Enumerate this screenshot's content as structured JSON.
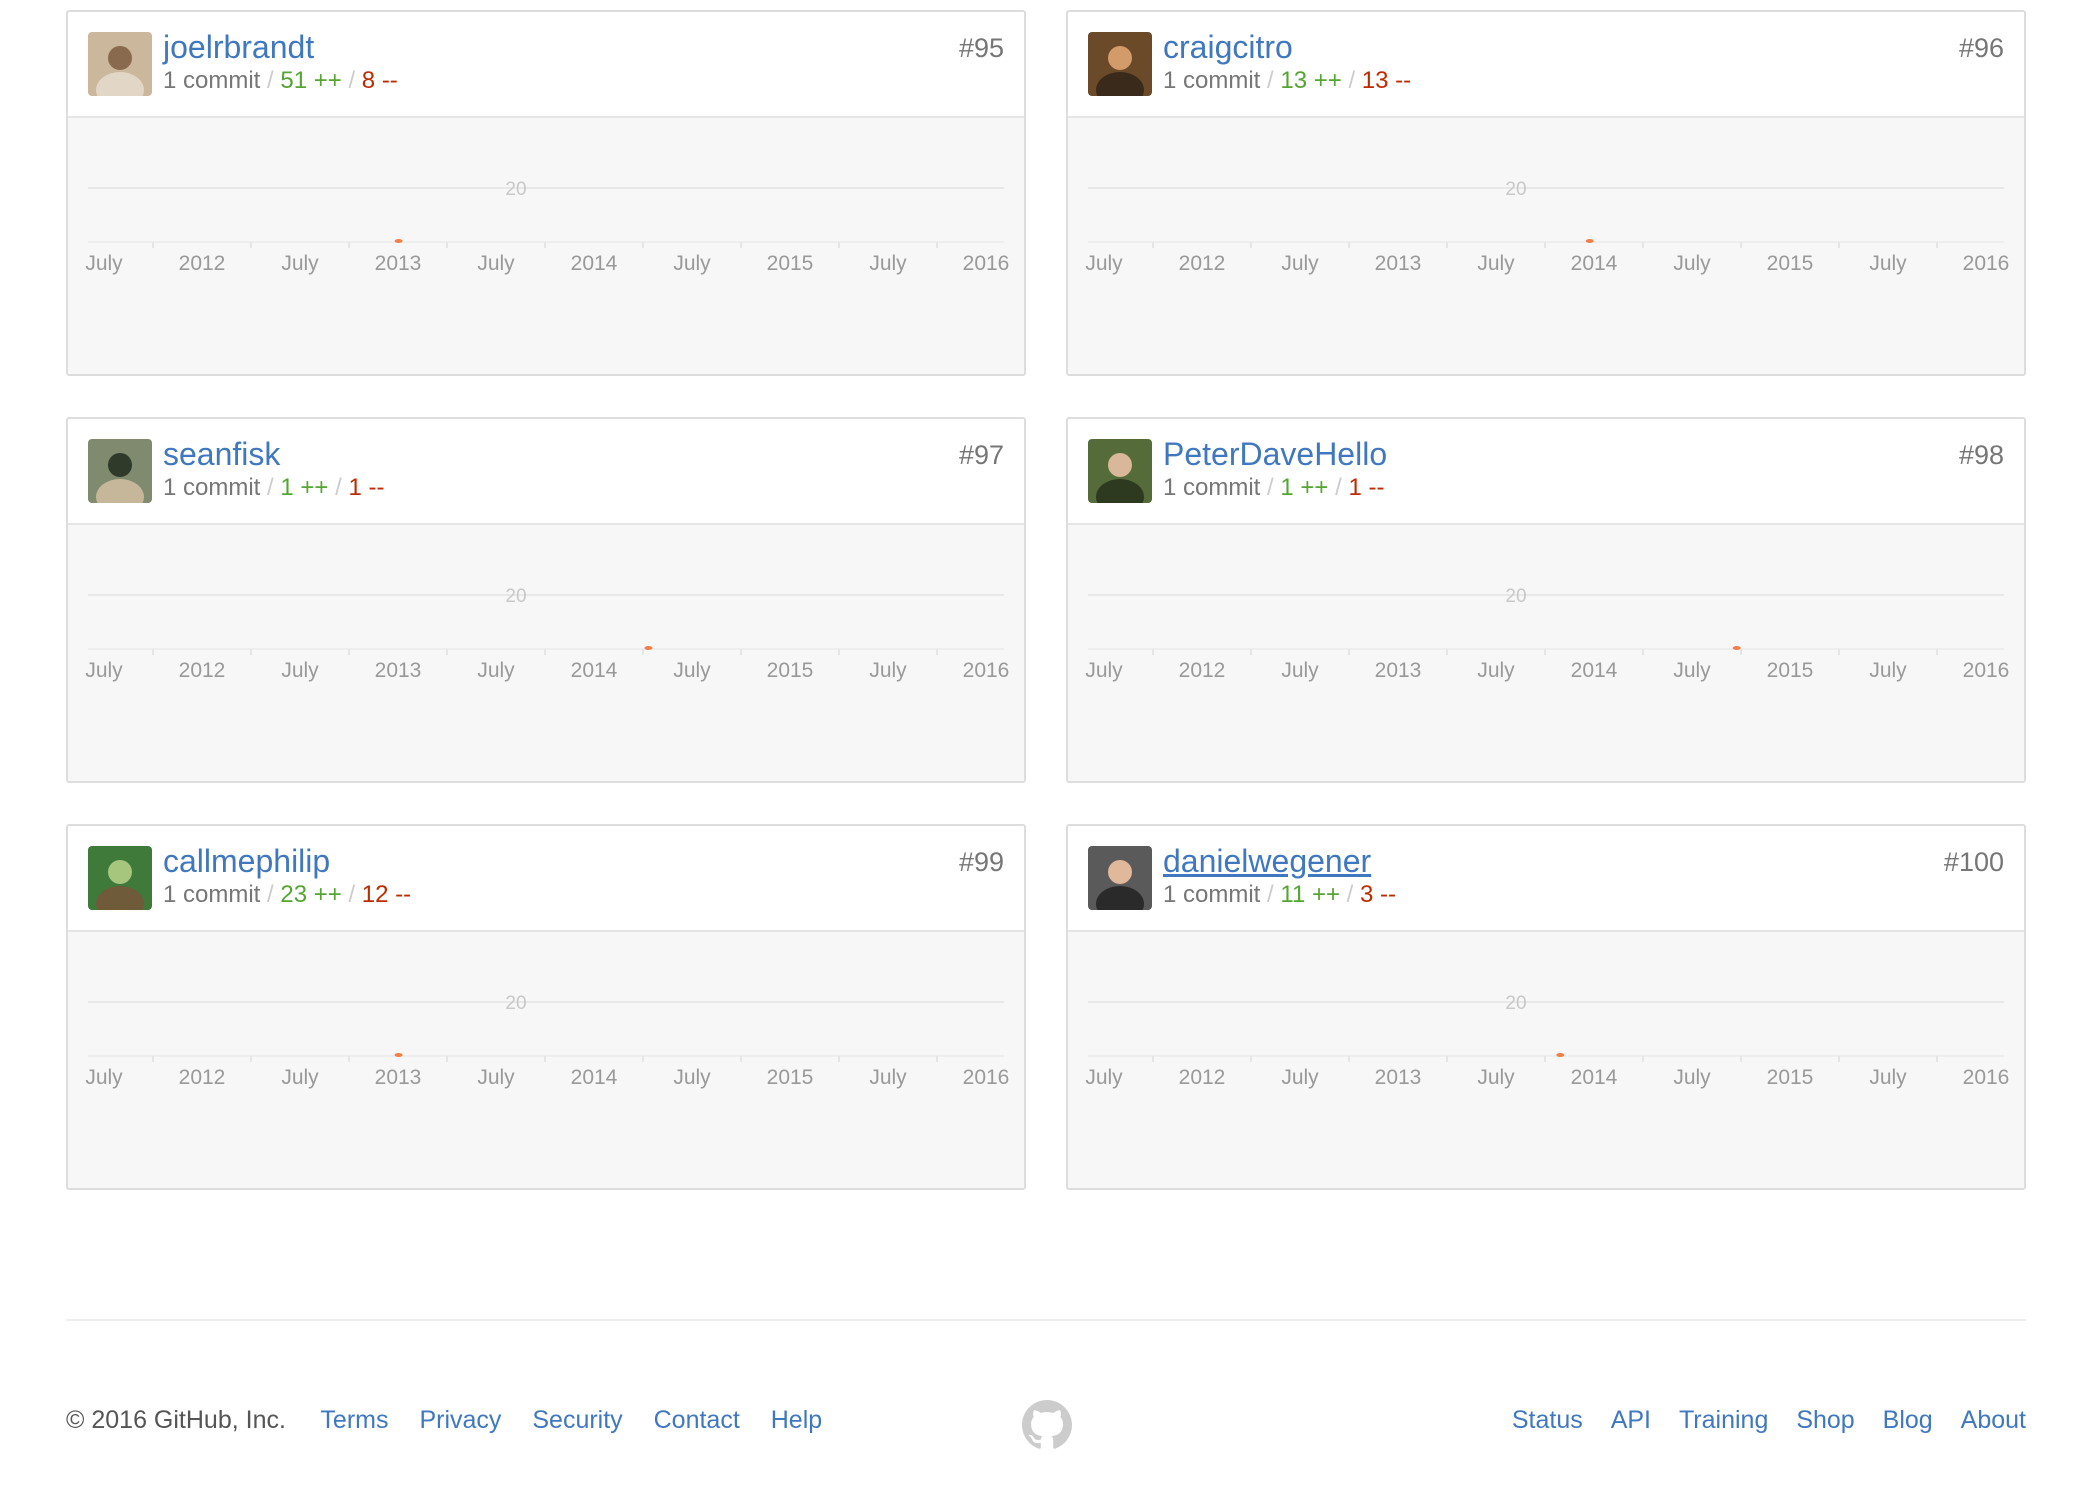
{
  "contributors": [
    {
      "username": "joelrbrandt",
      "rank": "#95",
      "commits": "1 commit",
      "additions": "51 ++",
      "deletions": "8 --",
      "avatar": "avatar-person-glasses",
      "dot_date": "2013",
      "link_underlined": false
    },
    {
      "username": "craigcitro",
      "rank": "#96",
      "commits": "1 commit",
      "additions": "13 ++",
      "deletions": "13 --",
      "avatar": "avatar-person-with-baby",
      "dot_date": "2014-02",
      "link_underlined": false
    },
    {
      "username": "seanfisk",
      "rank": "#97",
      "commits": "1 commit",
      "additions": "1 ++",
      "deletions": "1 --",
      "avatar": "avatar-person-outdoors",
      "dot_date": "2014-06",
      "link_underlined": false
    },
    {
      "username": "PeterDaveHello",
      "rank": "#98",
      "commits": "1 commit",
      "additions": "1 ++",
      "deletions": "1 --",
      "avatar": "avatar-person-helmet",
      "dot_date": "2014-12",
      "link_underlined": false
    },
    {
      "username": "callmephilip",
      "rank": "#99",
      "commits": "1 commit",
      "additions": "23 ++",
      "deletions": "12 --",
      "avatar": "avatar-person-field",
      "dot_date": "2013",
      "link_underlined": false
    },
    {
      "username": "danielwegener",
      "rank": "#100",
      "commits": "1 commit",
      "additions": "11 ++",
      "deletions": "3 --",
      "avatar": "avatar-person-portrait",
      "dot_date": "2013-12",
      "link_underlined": true
    }
  ],
  "chart_data": {
    "type": "line",
    "x_ticks": [
      "July",
      "2012",
      "July",
      "2013",
      "July",
      "2014",
      "July",
      "2015",
      "July",
      "2016"
    ],
    "y_ticks": [
      "20"
    ],
    "grid": true
  },
  "separator": "/",
  "footer": {
    "copyright": "© 2016 GitHub, Inc.",
    "left_links": [
      "Terms",
      "Privacy",
      "Security",
      "Contact",
      "Help"
    ],
    "right_links": [
      "Status",
      "API",
      "Training",
      "Shop",
      "Blog",
      "About"
    ],
    "logo_icon": "github-octocat-icon"
  },
  "colors": {
    "link": "#4078c0",
    "additions": "#55a532",
    "deletions": "#bd2c00",
    "dot": "#f17f49"
  }
}
